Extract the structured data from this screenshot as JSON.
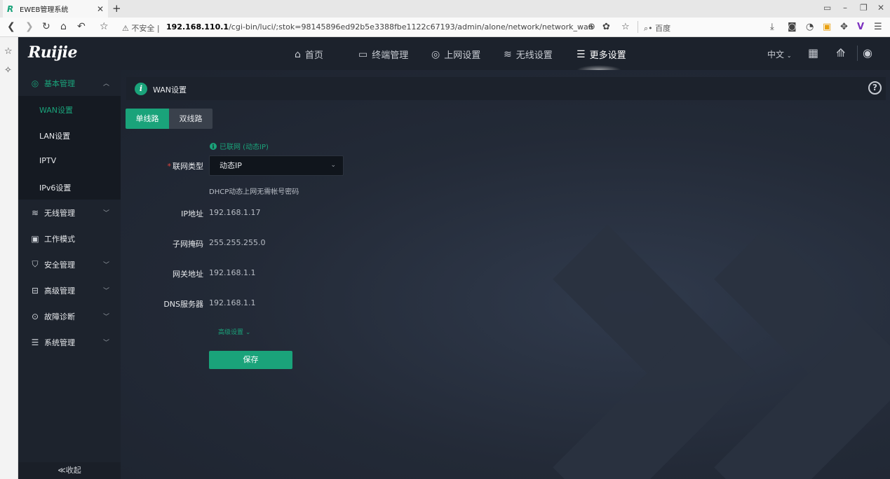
{
  "browser": {
    "tab_title": "EWEB管理系统",
    "tab_favicon": "R",
    "tab_close": "✕",
    "new_tab": "+",
    "insecure_label": "不安全",
    "url_host": "192.168.110.1",
    "url_path": "/cgi-bin/luci/;stok=98145896ed92b5e3388fbe1122c67193/admin/alone/network/network_wan",
    "search_placeholder": "百度"
  },
  "app": {
    "logo": "Ruijie",
    "nav": [
      {
        "label": "首页",
        "icon": "home-icon"
      },
      {
        "label": "终端管理",
        "icon": "monitor-icon"
      },
      {
        "label": "上网设置",
        "icon": "globe-icon"
      },
      {
        "label": "无线设置",
        "icon": "wifi-icon"
      },
      {
        "label": "更多设置",
        "icon": "sliders-icon",
        "active": true
      }
    ],
    "language": "中文",
    "sidebar": {
      "groups": [
        {
          "label": "基本管理",
          "icon": "globe-icon",
          "open": true
        },
        {
          "label": "无线管理",
          "icon": "wifi-icon"
        },
        {
          "label": "工作模式",
          "icon": "mode-icon"
        },
        {
          "label": "安全管理",
          "icon": "shield-icon"
        },
        {
          "label": "高级管理",
          "icon": "toolbox-icon"
        },
        {
          "label": "故障诊断",
          "icon": "diagnose-icon"
        },
        {
          "label": "系统管理",
          "icon": "sliders-icon"
        }
      ],
      "sub_items": [
        "WAN设置",
        "LAN设置",
        "IPTV",
        "IPv6设置"
      ],
      "collapse_label": "≪收起"
    },
    "page_title": "WAN设置",
    "segments": [
      "单线路",
      "双线路"
    ],
    "status_text": "已联网 (动态IP)",
    "form": {
      "type_label": "联网类型",
      "type_value": "动态IP",
      "hint": "DHCP动态上网无需帐号密码",
      "ip_label": "IP地址",
      "ip_value": "192.168.1.17",
      "mask_label": "子网掩码",
      "mask_value": "255.255.255.0",
      "gateway_label": "网关地址",
      "gateway_value": "192.168.1.1",
      "dns_label": "DNS服务器",
      "dns_value": "192.168.1.1",
      "advanced_label": "高级设置 ⌄",
      "save_label": "保存"
    },
    "colors": {
      "accent": "#1aa37a",
      "nav_bg": "#1c222c",
      "sidebar_bg": "#1d232d",
      "required": "#e0443e"
    }
  }
}
